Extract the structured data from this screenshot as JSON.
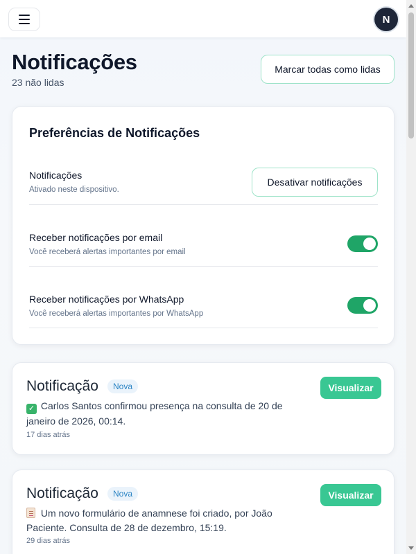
{
  "header": {
    "avatar_initial": "N",
    "title": "Notificações",
    "unread": "23 não lidas",
    "mark_all_label": "Marcar todas como lidas"
  },
  "preferences": {
    "title": "Preferências de Notificações",
    "push": {
      "label": "Notificações",
      "desc": "Ativado neste dispositivo.",
      "button": "Desativar notificações"
    },
    "email": {
      "label": "Receber notificações por email",
      "desc": "Você receberá alertas importantes por email",
      "enabled": true
    },
    "whatsapp": {
      "label": "Receber notificações por WhatsApp",
      "desc": "Você receberá alertas importantes por WhatsApp",
      "enabled": true
    }
  },
  "notifications": [
    {
      "title": "Notificação",
      "badge": "Nova",
      "icon": "check-mark-emoji",
      "message": "Carlos Santos confirmou presença na consulta de 20 de janeiro de 2026, 00:14.",
      "time": "17 dias atrás",
      "action": "Visualizar"
    },
    {
      "title": "Notificação",
      "badge": "Nova",
      "icon": "document-emoji",
      "message": "Um novo formulário de anamnese foi criado, por João Paciente. Consulta de 28 de dezembro, 15:19.",
      "time": "29 dias atrás",
      "action": "Visualizar"
    }
  ],
  "colors": {
    "accent_green": "#39c793",
    "toggle_on": "#1fa567",
    "badge_blue": "#2b84c4",
    "outline_green": "#9ee3c9"
  }
}
